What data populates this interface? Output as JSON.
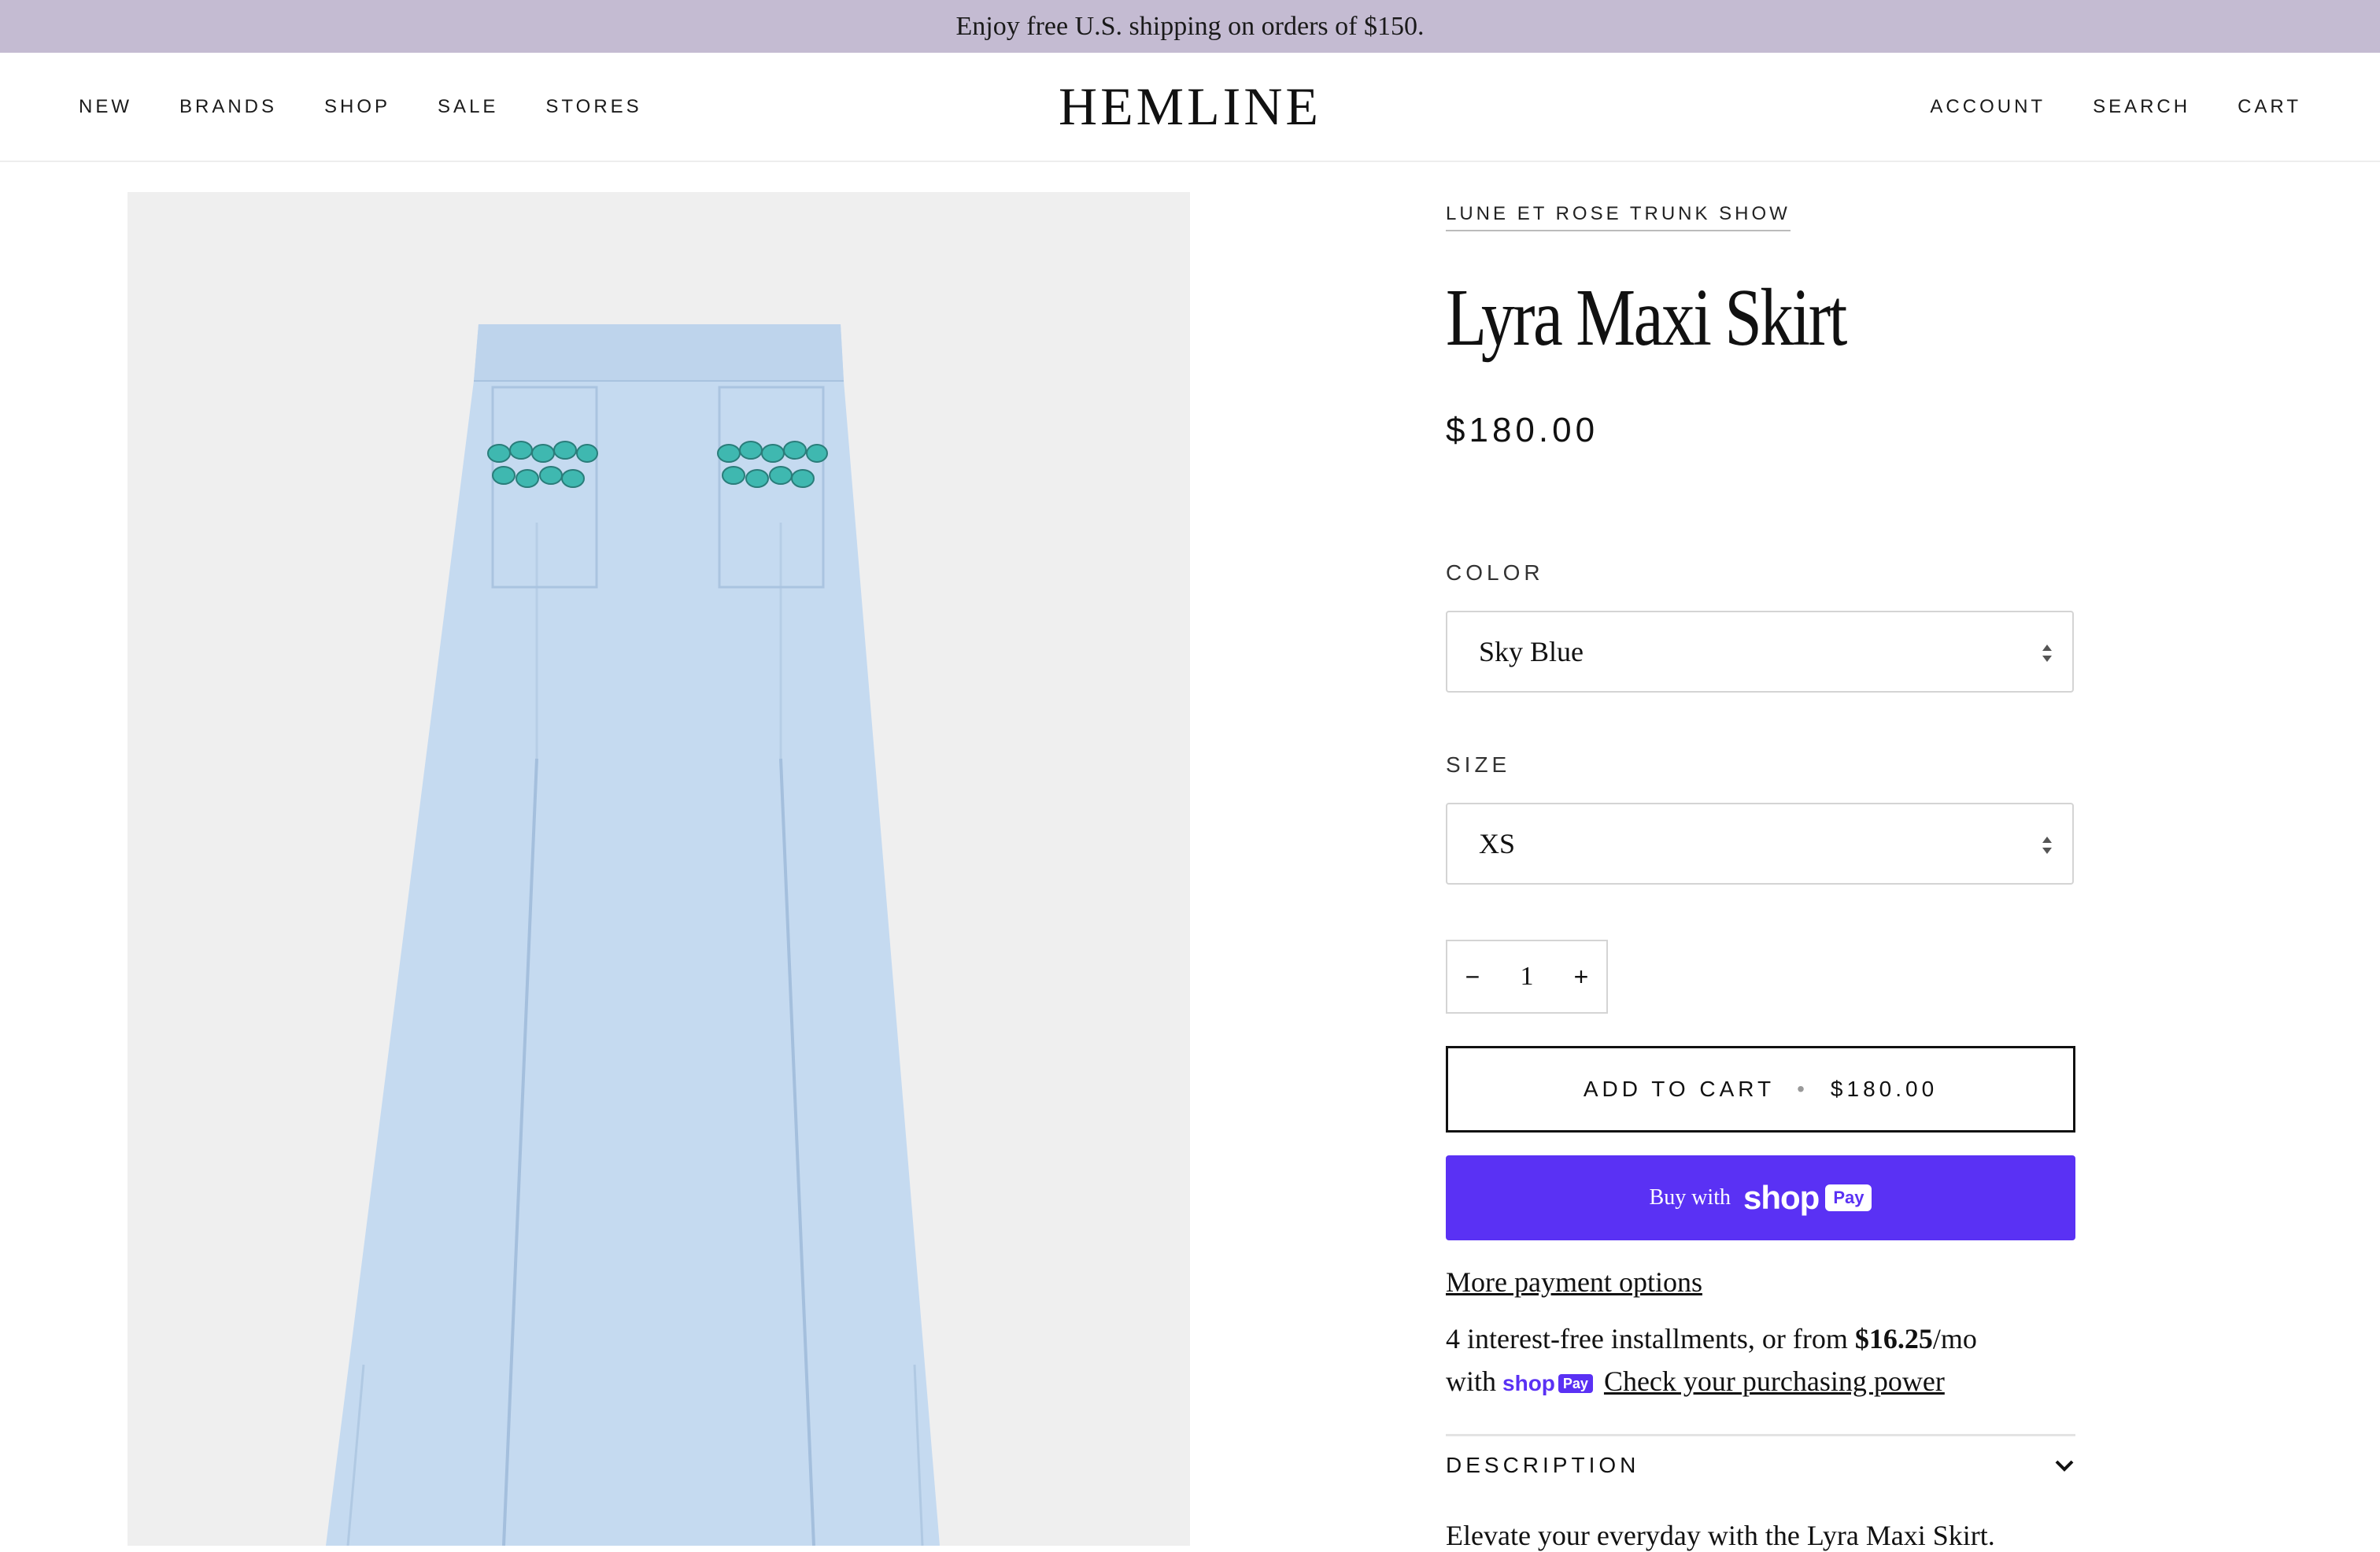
{
  "promo": {
    "text": "Enjoy free U.S. shipping on orders of $150."
  },
  "header": {
    "nav_left": [
      "NEW",
      "BRANDS",
      "SHOP",
      "SALE",
      "STORES"
    ],
    "logo": "HEMLINE",
    "nav_right": [
      "ACCOUNT",
      "SEARCH",
      "CART"
    ]
  },
  "product": {
    "vendor": "LUNE ET ROSE TRUNK SHOW",
    "title": "Lyra Maxi Skirt",
    "price": "$180.00",
    "image_icon": "skirt-product-image",
    "color_label": "COLOR",
    "color_value": "Sky Blue",
    "size_label": "SIZE",
    "size_value": "XS",
    "quantity": {
      "minus": "−",
      "value": "1",
      "plus": "+"
    },
    "add_to_cart": {
      "label": "ADD TO CART",
      "separator": "•",
      "price": "$180.00"
    },
    "shop_pay": {
      "prefix": "Buy with",
      "brand": "shop",
      "badge": "Pay",
      "color": "#5a31f4"
    },
    "more_payment_options": "More payment options",
    "installments": {
      "text_before": "4 interest-free installments, or from",
      "amount": "$16.25",
      "suffix": "/mo",
      "with": "with",
      "brand": "shop",
      "badge": "Pay",
      "link": "Check your purchasing power"
    },
    "description": {
      "title": "DESCRIPTION",
      "text": "Elevate your everyday with the Lyra Maxi Skirt."
    }
  },
  "colors": {
    "promo_bg": "#c4bbd2",
    "skirt": "#c5daf0",
    "image_bg": "#efefef",
    "shop_pay": "#5a31f4"
  }
}
